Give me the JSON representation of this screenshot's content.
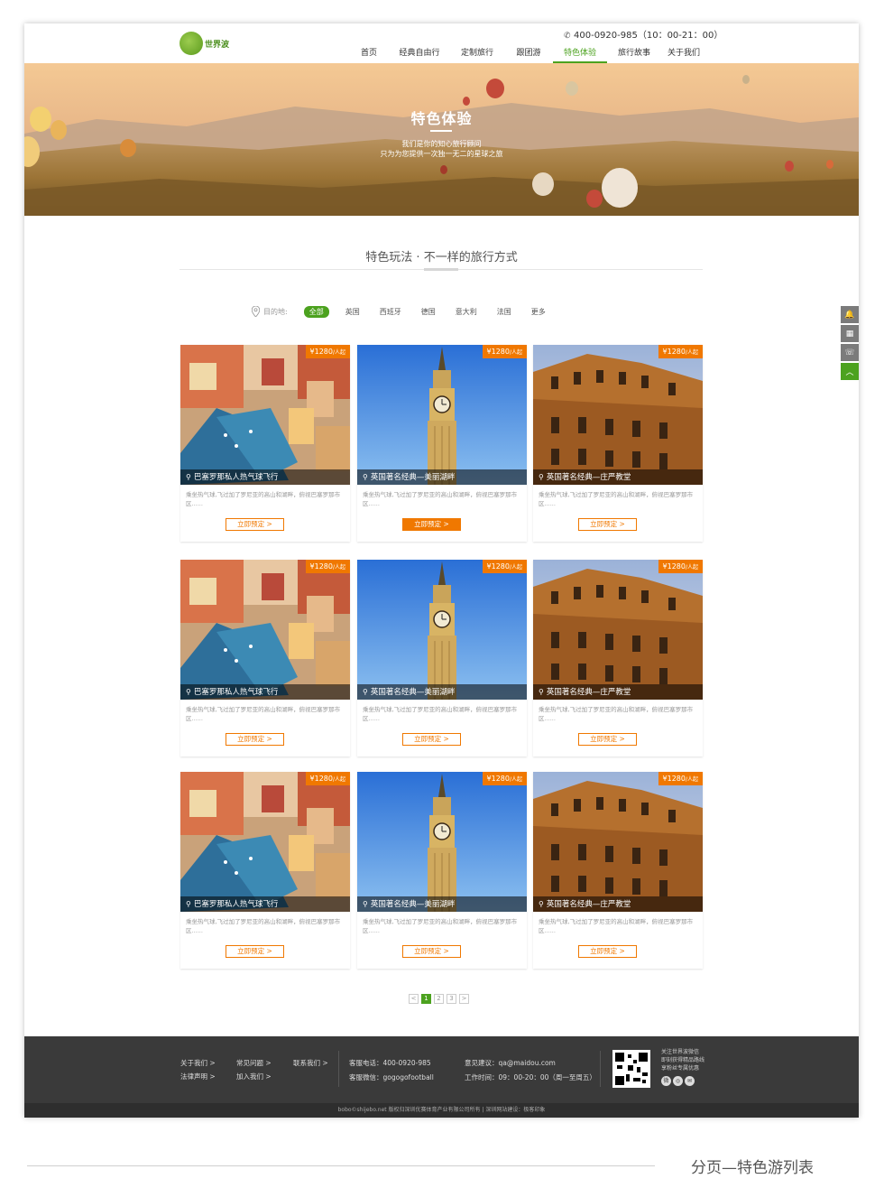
{
  "header": {
    "logo_text": "世界波",
    "phone": "400-0920-985",
    "hours": "（10：00-21：00）",
    "nav": [
      {
        "label": "首页",
        "active": false
      },
      {
        "label": "经典自由行",
        "active": false
      },
      {
        "label": "定制旅行",
        "active": false
      },
      {
        "label": "跟团游",
        "active": false
      },
      {
        "label": "特色体验",
        "active": true
      },
      {
        "label": "旅行故事",
        "active": false
      },
      {
        "label": "关于我们",
        "active": false
      }
    ]
  },
  "banner": {
    "title": "特色体验",
    "line1": "我们是你的知心旅行顾问",
    "line2": "只为为您提供一次独一无二的星球之旅"
  },
  "section": {
    "title": "特色玩法 · 不一样的旅行方式"
  },
  "filter": {
    "label": "目的地:",
    "options": [
      "全部",
      "英国",
      "西班牙",
      "德国",
      "意大利",
      "法国",
      "更多"
    ],
    "active_index": 0
  },
  "card_templates": [
    {
      "title": "巴塞罗那私人热气球飞行",
      "image": "coastal-town"
    },
    {
      "title": "英国著名经典—美丽湖畔",
      "image": "clock-tower"
    },
    {
      "title": "英国著名经典—庄严教堂",
      "image": "historic-building"
    }
  ],
  "card_common": {
    "price": "¥1280",
    "price_unit": "/人起",
    "desc": "乘坐热气球,飞过加了罗尼亚的高山和湖畔，俯视巴塞罗那市区......",
    "button": "立即预定 >"
  },
  "filled_button_card": 1,
  "pager": {
    "prev": "<",
    "pages": [
      "1",
      "2",
      "3"
    ],
    "next": ">",
    "current": 0
  },
  "side_tools": [
    "chat-icon",
    "qr-code-icon",
    "phone-icon",
    "back-to-top-icon"
  ],
  "footer": {
    "links": [
      "关于我们 >",
      "常见问题 >",
      "联系我们 >",
      "法律声明 >",
      "加入我们 >"
    ],
    "service_phone": "客服电话：400-0920-985",
    "service_wechat": "客服微信：gogogofootball",
    "feedback": "意见建议：qa@maidou.com",
    "work_time": "工作时间：09：00-20：00（周一至周五）",
    "wechat_lines": [
      "关注世界波微信",
      "即刻获得精品路线",
      "享粉丝专属优惠"
    ],
    "copyright": "bobo©shijebo.net 版权归深圳优赛体育产业有限公司所有  |  深圳网站建设：极客印象"
  },
  "page_caption": "分页—特色游列表"
}
